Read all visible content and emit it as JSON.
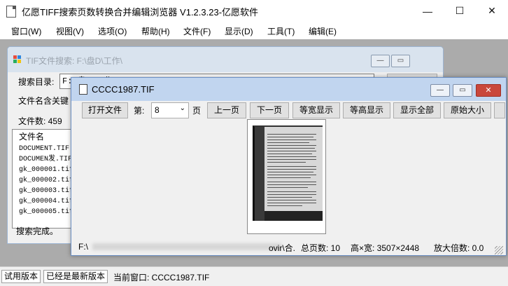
{
  "app": {
    "title": "亿愿TIFF搜索页数转换合并编辑浏览器 V1.2.3.23-亿愿软件",
    "minimize": "—",
    "maximize": "☐",
    "close": "✕"
  },
  "menu": [
    "窗口(W)",
    "视图(V)",
    "选项(O)",
    "帮助(H)",
    "文件(F)",
    "显示(D)",
    "工具(T)",
    "编辑(E)"
  ],
  "search_window": {
    "title": "TIF文件搜索: F:\\盘D\\工作\\",
    "dir_label": "搜索目录:",
    "dir_value": "F:\\盘D\\工作\\",
    "keyword_label": "文件名含关键",
    "count_label": "文件数: 459",
    "list_header": "文件名",
    "files": [
      "DOCUMENT.TIF",
      "DOCUMEN发.TIF",
      "gk_000001.tif",
      "gk_000002.tif",
      "gk_000003.tif",
      "gk_000004.tif",
      "gk_000005.tif"
    ],
    "status": "搜索完成。"
  },
  "viewer": {
    "title": "CCCC1987.TIF",
    "open_button": "打开文件",
    "page_label": "第:",
    "page_value": "8",
    "page_unit": "页",
    "buttons": [
      "上一页",
      "下一页",
      "等宽显示",
      "等高显示",
      "显示全部",
      "原始大小"
    ],
    "status_path": "F:\\",
    "status_path_tail": "ovir\\合.",
    "status_pages": "总页数: 10",
    "status_size": "高×宽: 3507×2448",
    "status_zoom": "放大倍数: 0.0"
  },
  "statusbar": {
    "trial": "试用版本",
    "latest": "已经是最新版本",
    "current": "当前窗口: CCCC1987.TIF"
  }
}
